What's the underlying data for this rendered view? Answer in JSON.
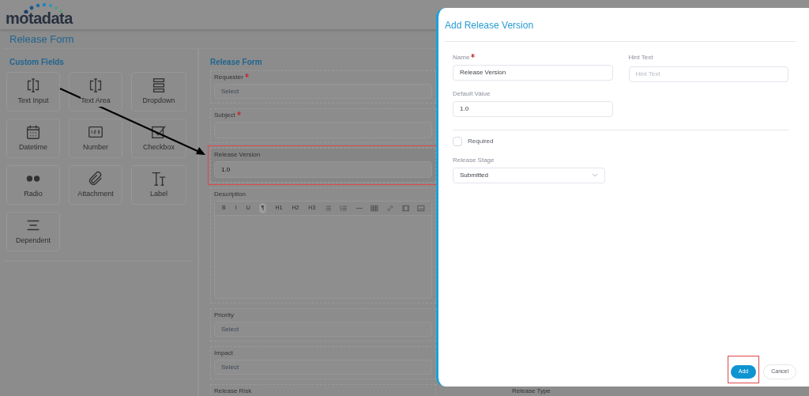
{
  "logo": "motadata",
  "page_title": "Release Form",
  "custom_fields": {
    "title": "Custom Fields",
    "items": [
      {
        "kind": "text_input",
        "label": "Text Input"
      },
      {
        "kind": "text_area",
        "label": "Text Area"
      },
      {
        "kind": "dropdown",
        "label": "Dropdown"
      },
      {
        "kind": "datetime",
        "label": "Datetime"
      },
      {
        "kind": "number",
        "label": "Number"
      },
      {
        "kind": "checkbox",
        "label": "Checkbox"
      },
      {
        "kind": "radio",
        "label": "Radio"
      },
      {
        "kind": "attachment",
        "label": "Attachment"
      },
      {
        "kind": "label",
        "label": "Label"
      },
      {
        "kind": "dependent",
        "label": "Dependent"
      }
    ]
  },
  "form": {
    "title": "Release Form",
    "fields": [
      {
        "kind": "select",
        "label": "Requester",
        "required": true,
        "placeholder": "Select",
        "highlighted": false
      },
      {
        "kind": "input",
        "label": "Subject",
        "required": true,
        "highlighted": false
      },
      {
        "kind": "input",
        "label": "Release Version",
        "required": false,
        "value": "1.0",
        "highlighted": true
      },
      {
        "kind": "editor",
        "label": "Description",
        "required": false,
        "highlighted": false,
        "toolbar": [
          {
            "label": "B",
            "selected": false
          },
          {
            "label": "I",
            "selected": false
          },
          {
            "label": "U",
            "selected": false
          },
          {
            "label": "¶",
            "selected": true
          },
          {
            "label": "H1",
            "selected": false
          },
          {
            "label": "H2",
            "selected": false
          },
          {
            "label": "H3",
            "selected": false
          }
        ]
      },
      {
        "kind": "select",
        "label": "Priority",
        "required": false,
        "placeholder": "Select",
        "highlighted": false
      },
      {
        "kind": "select",
        "label": "Impact",
        "required": false,
        "placeholder": "Select",
        "highlighted": false
      },
      {
        "kind": "label_only",
        "label": "Release Risk",
        "required": false,
        "highlighted": false
      }
    ],
    "side_label": "Release Type"
  },
  "drawer": {
    "title": "Add Release Version",
    "name": {
      "label": "Name",
      "required": true,
      "value": "Release Version"
    },
    "hint": {
      "label": "Hint Text",
      "placeholder": "Hint Text"
    },
    "default_value": {
      "label": "Default Value",
      "value": "1.0"
    },
    "required_option": {
      "label": "Required",
      "checked": false
    },
    "stage": {
      "label": "Release Stage",
      "value": "Submitted"
    },
    "buttons": [
      {
        "kind": "primary",
        "label": "Add",
        "highlighted": true
      },
      {
        "kind": "secondary",
        "label": "Cancel",
        "highlighted": false
      }
    ]
  }
}
